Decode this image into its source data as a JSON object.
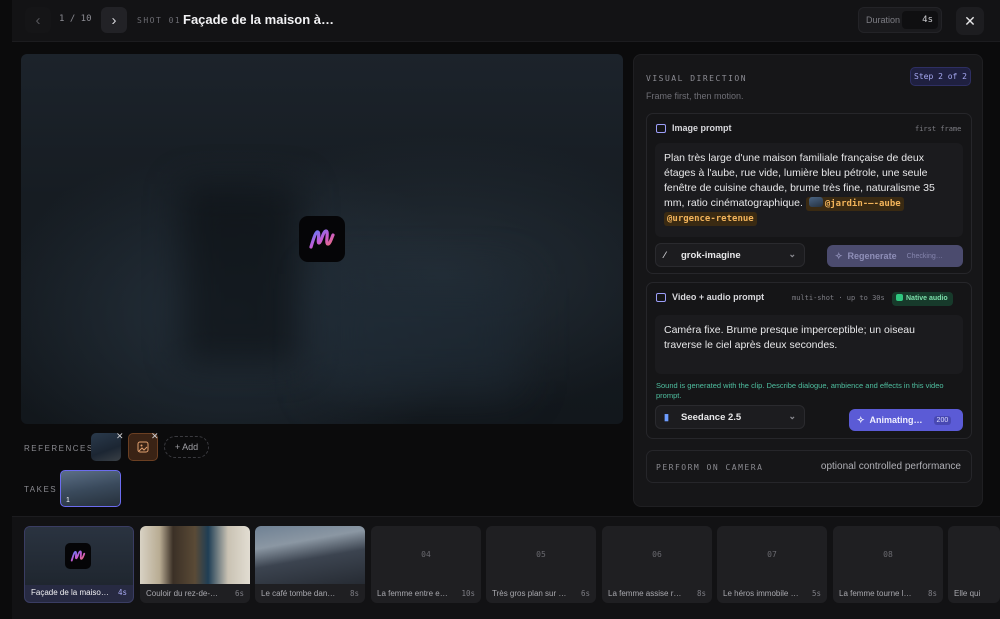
{
  "header": {
    "counter": "1 / 10",
    "shot_label": "SHOT 01",
    "title": "Façade de la maison à…",
    "duration_label": "Duration",
    "duration_value": "4s"
  },
  "left": {
    "references_label": "REFERENCES",
    "add_label": "+ Add",
    "takes_label": "TAKES",
    "take_number": "1"
  },
  "panel": {
    "title": "VISUAL DIRECTION",
    "subtitle": "Frame first, then motion.",
    "step": "Step 2 of 2",
    "image_prompt": {
      "heading": "Image prompt",
      "tag": "first frame",
      "text": "Plan très large d'une maison familiale française de deux étages à l'aube, rue vide, lumière bleu pétrole, une seule fenêtre de cuisine chaude, brume très fine, naturalisme 35 mm, ratio cinématographique.",
      "chip1": "@jardin-—-aube",
      "chip2": "@urgence-retenue",
      "model": "grok-imagine",
      "regenerate": "Regenerate",
      "status": "Checking…"
    },
    "video_prompt": {
      "heading": "Video + audio prompt",
      "meta": "multi-shot · up to 30s",
      "native": "Native audio",
      "text": "Caméra fixe. Brume presque imperceptible; un oiseau traverse le ciel après deux secondes.",
      "note": "Sound is generated with the clip. Describe dialogue, ambience and effects in this video prompt.",
      "model": "Seedance 2.5",
      "animate": "Animating…",
      "cost": "200"
    },
    "perform": {
      "label": "PERFORM ON CAMERA",
      "value": "optional controlled performance"
    }
  },
  "shots": [
    {
      "num": "",
      "caption": "Façade de la maiso…",
      "dur": "4s"
    },
    {
      "num": "",
      "caption": "Couloir du rez-de-…",
      "dur": "6s"
    },
    {
      "num": "",
      "caption": "Le café tombe dan…",
      "dur": "8s"
    },
    {
      "num": "04",
      "caption": "La femme entre e…",
      "dur": "10s"
    },
    {
      "num": "05",
      "caption": "Très gros plan sur …",
      "dur": "6s"
    },
    {
      "num": "06",
      "caption": "La femme assise r…",
      "dur": "8s"
    },
    {
      "num": "07",
      "caption": "Le héros immobile …",
      "dur": "5s"
    },
    {
      "num": "08",
      "caption": "La femme tourne l…",
      "dur": "8s"
    },
    {
      "num": "",
      "caption": "Elle qui",
      "dur": ""
    }
  ]
}
